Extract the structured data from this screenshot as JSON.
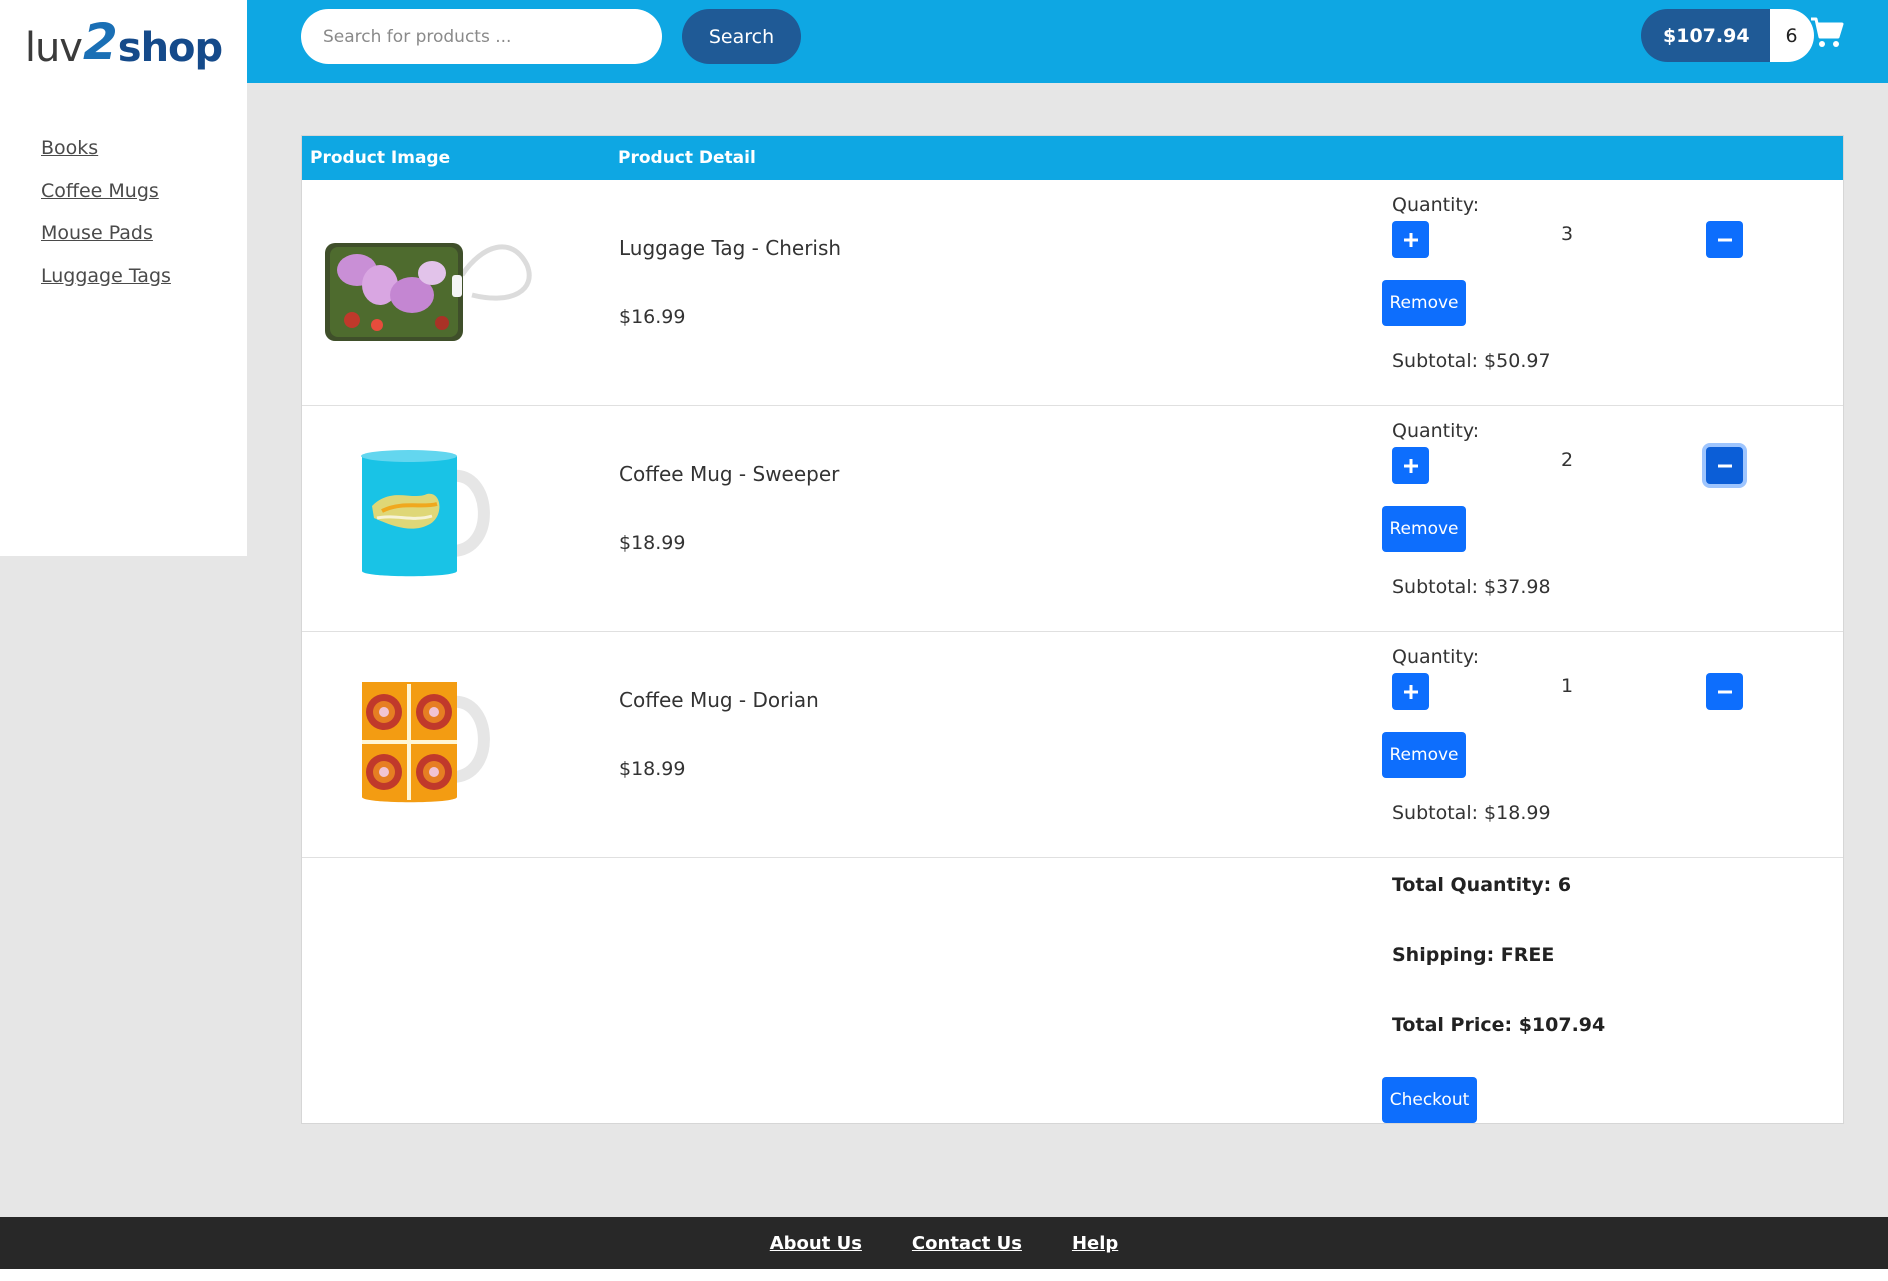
{
  "header": {
    "logo": {
      "part1": "luv",
      "part2": "2",
      "part3": "shop"
    },
    "search": {
      "placeholder": "Search for products ...",
      "button_label": "Search"
    },
    "cart_status": {
      "total_price": "$107.94",
      "total_quantity": "6"
    },
    "icons": {
      "cart": "shopping-cart-icon"
    }
  },
  "sidebar": {
    "items": [
      {
        "label": "Books"
      },
      {
        "label": "Coffee Mugs"
      },
      {
        "label": "Mouse Pads"
      },
      {
        "label": "Luggage Tags"
      }
    ]
  },
  "cart": {
    "columns": {
      "image": "Product Image",
      "detail": "Product Detail"
    },
    "quantity_label": "Quantity:",
    "remove_label": "Remove",
    "items": [
      {
        "name": "Luggage Tag - Cherish",
        "price": "$16.99",
        "quantity": "3",
        "subtotal": "Subtotal: $50.97"
      },
      {
        "name": "Coffee Mug - Sweeper",
        "price": "$18.99",
        "quantity": "2",
        "subtotal": "Subtotal: $37.98"
      },
      {
        "name": "Coffee Mug - Dorian",
        "price": "$18.99",
        "quantity": "1",
        "subtotal": "Subtotal: $18.99"
      }
    ],
    "summary": {
      "total_quantity": "Total Quantity: 6",
      "shipping": "Shipping: FREE",
      "total_price": "Total Price: $107.94",
      "checkout_label": "Checkout"
    }
  },
  "footer": {
    "links": [
      {
        "label": "About Us"
      },
      {
        "label": "Contact Us"
      },
      {
        "label": "Help"
      }
    ]
  },
  "colors": {
    "topbar": "#0ea7e3",
    "dark_button": "#1f5a96",
    "primary_button": "#0d6efd",
    "footer": "#282828"
  }
}
